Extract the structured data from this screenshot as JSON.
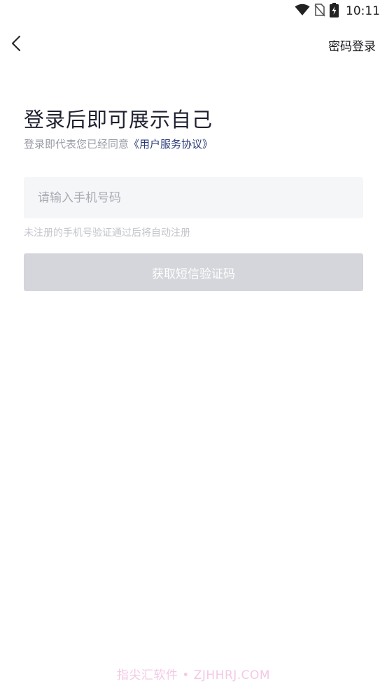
{
  "status_bar": {
    "time": "10:11",
    "icons": [
      "wifi-icon",
      "no-sim-icon",
      "battery-charging-icon"
    ]
  },
  "nav": {
    "back_icon": "chevron-left-icon",
    "password_login_label": "密码登录"
  },
  "main": {
    "title": "登录后即可展示自己",
    "subtitle_prefix": "登录即代表您已经同意",
    "agreement_link": "《用户服务协议》",
    "phone_input": {
      "placeholder": "请输入手机号码",
      "value": ""
    },
    "hint": "未注册的手机号验证通过后将自动注册",
    "get_code_button": "获取短信验证码"
  },
  "watermark": "指尖汇软件 • ZJHHRJ.COM",
  "colors": {
    "title": "#1f2130",
    "link": "#2a3b7a",
    "button_disabled": "#d5d6db",
    "input_bg": "#f5f6f8"
  }
}
